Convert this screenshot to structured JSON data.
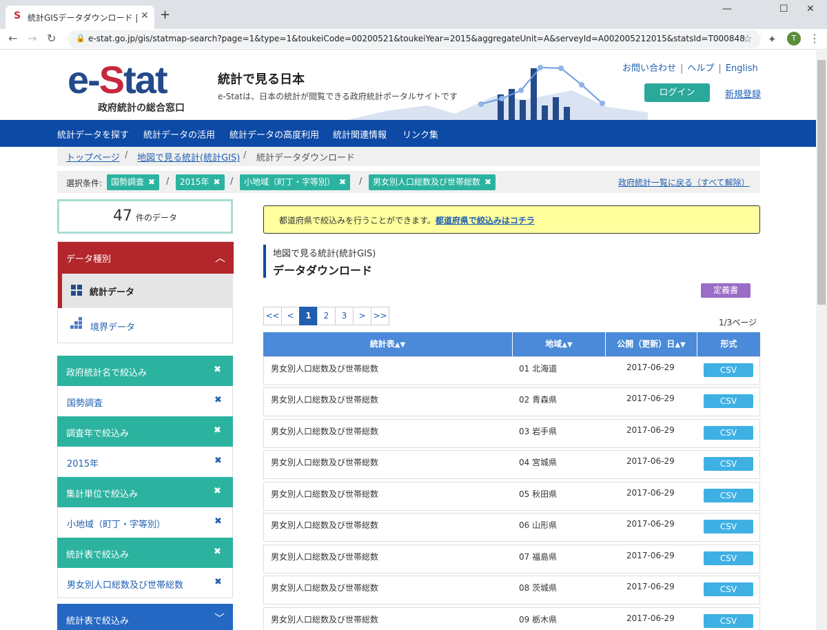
{
  "browser": {
    "tab_title": "統計GISデータダウンロード | 政府統計",
    "url": "e-stat.go.jp/gis/statmap-search?page=1&type=1&toukeiCode=00200521&toukeiYear=2015&aggregateUnit=A&serveyId=A002005212015&statsId=T000848",
    "avatar": "T"
  },
  "header": {
    "logo_e": "e-",
    "logo_s": "S",
    "logo_rest": "tat",
    "logo_sub": "政府統計の総合窓口",
    "title": "統計で見る日本",
    "desc": "e-Statは、日本の統計が閲覧できる政府統計ポータルサイトです",
    "links": [
      "お問い合わせ",
      "ヘルプ",
      "English"
    ],
    "login": "ログイン",
    "register": "新規登録"
  },
  "gnav": [
    "統計データを探す",
    "統計データの活用",
    "統計データの高度利用",
    "統計関連情報",
    "リンク集"
  ],
  "breadcrumb": [
    "トップページ",
    "地図で見る統計(統計GIS)",
    "統計データダウンロード"
  ],
  "conditions": {
    "label": "選択条件:",
    "chips": [
      "国勢調査",
      "2015年",
      "小地域（町丁・字等別）",
      "男女別人口総数及び世帯総数"
    ],
    "clear": "政府統計一覧に戻る（すべて解除）"
  },
  "count": {
    "num": "47",
    "unit": "件のデータ"
  },
  "sidebar": {
    "data_type_head": "データ種別",
    "selected": "統計データ",
    "alternative": "境界データ",
    "filters": [
      {
        "head": "政府統計名で絞込み",
        "value": "国勢調査"
      },
      {
        "head": "調査年で絞込み",
        "value": "2015年"
      },
      {
        "head": "集計単位で絞込み",
        "value": "小地域（町丁・字等別）"
      },
      {
        "head": "統計表で絞込み",
        "value": "男女別人口総数及び世帯総数"
      }
    ],
    "last_head": "統計表で絞込み"
  },
  "notice": {
    "text": "都道府県で絞込みを行うことができます。",
    "link": "都道府県で絞込みはコチラ"
  },
  "section": {
    "sub": "地図で見る統計(統計GIS)",
    "title": "データダウンロード",
    "def_button": "定義書"
  },
  "pager": {
    "buttons": [
      "<<",
      "<",
      "1",
      "2",
      "3",
      ">",
      ">>"
    ],
    "active": "1",
    "info": "1/3ページ"
  },
  "table": {
    "headers": [
      "統計表",
      "地域",
      "公開（更新）日",
      "形式"
    ],
    "rows": [
      {
        "name": "男女別人口総数及び世帯総数",
        "area": "01 北海道",
        "date": "2017-06-29",
        "format": "CSV"
      },
      {
        "name": "男女別人口総数及び世帯総数",
        "area": "02 青森県",
        "date": "2017-06-29",
        "format": "CSV"
      },
      {
        "name": "男女別人口総数及び世帯総数",
        "area": "03 岩手県",
        "date": "2017-06-29",
        "format": "CSV"
      },
      {
        "name": "男女別人口総数及び世帯総数",
        "area": "04 宮城県",
        "date": "2017-06-29",
        "format": "CSV"
      },
      {
        "name": "男女別人口総数及び世帯総数",
        "area": "05 秋田県",
        "date": "2017-06-29",
        "format": "CSV"
      },
      {
        "name": "男女別人口総数及び世帯総数",
        "area": "06 山形県",
        "date": "2017-06-29",
        "format": "CSV"
      },
      {
        "name": "男女別人口総数及び世帯総数",
        "area": "07 福島県",
        "date": "2017-06-29",
        "format": "CSV"
      },
      {
        "name": "男女別人口総数及び世帯総数",
        "area": "08 茨城県",
        "date": "2017-06-29",
        "format": "CSV"
      },
      {
        "name": "男女別人口総数及び世帯総数",
        "area": "09 栃木県",
        "date": "2017-06-29",
        "format": "CSV"
      }
    ]
  },
  "colors": {
    "nav": "#0d4aa5",
    "accent_red": "#b3262b",
    "teal": "#2cb3a0",
    "table_head": "#4a8ad8",
    "csv": "#3fb0e3"
  }
}
